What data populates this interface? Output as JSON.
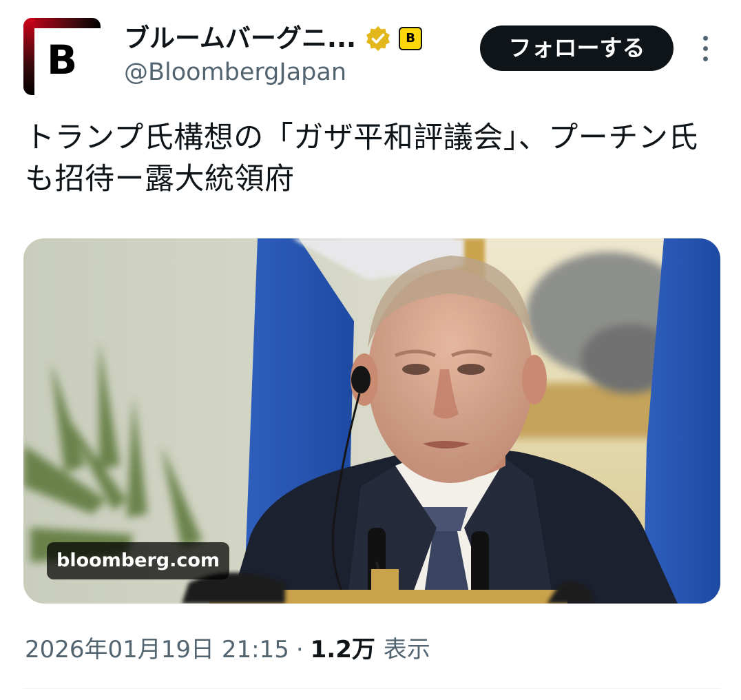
{
  "account": {
    "display_name": "ブルームバーグニ...",
    "handle": "@BloombergJapan",
    "avatar_letter": "B",
    "avatar_icon": "bloomberg-logo",
    "verified_icon": "gold-verified-badge",
    "affiliate_badge_letter": "B"
  },
  "actions": {
    "follow_label": "フォローする",
    "more_icon": "vertical-ellipsis"
  },
  "tweet": {
    "text": "トランプ氏構想の「ガザ平和評議会」、プーチン氏も招待ー露大統領府"
  },
  "media": {
    "domain": "bloomberg.com"
  },
  "meta": {
    "timestamp": "2026年01月19日 21:15",
    "separator": "·",
    "views_count": "1.2万",
    "views_label": "表示"
  },
  "colors": {
    "text_primary": "#0f1419",
    "text_secondary": "#536471",
    "follow_bg": "#0f1419",
    "verified_gold": "#e2b719",
    "affiliate_yellow": "#ffd60a",
    "brand_red": "#d0021b"
  }
}
